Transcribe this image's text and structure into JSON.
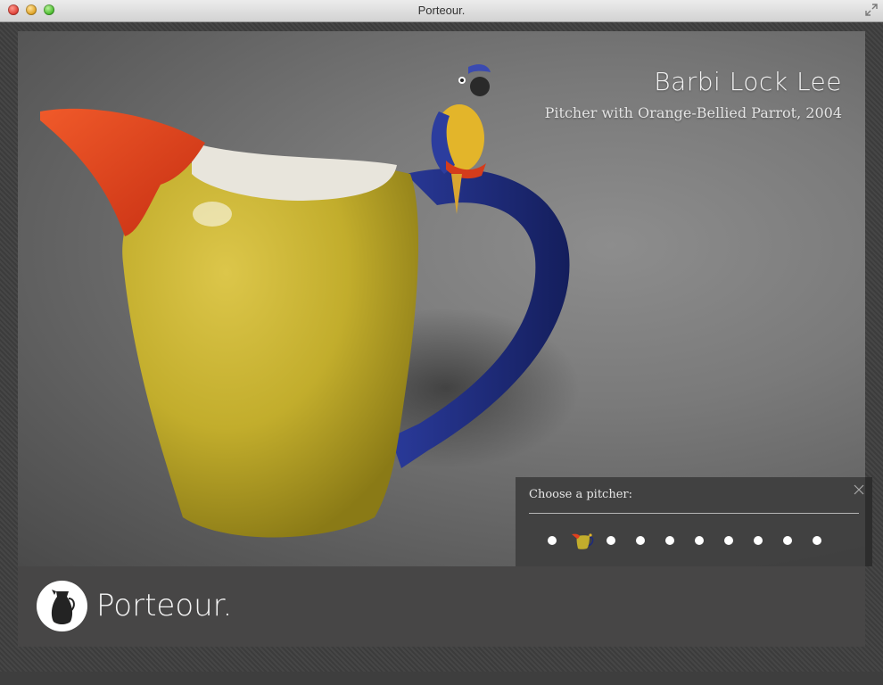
{
  "window": {
    "title": "Porteour."
  },
  "artwork": {
    "artist": "Barbi Lock Lee",
    "title": "Pitcher with Orange-Bellied Parrot, 2004",
    "colors": {
      "body": "#c2ad2c",
      "spout": "#e0401e",
      "handle": "#1d2a7a",
      "parrot": "#e3b52a"
    }
  },
  "brand": {
    "name": "Porteour."
  },
  "chooser": {
    "label": "Choose a pitcher:",
    "close_icon": "close-icon",
    "count": 10,
    "selected_index": 1
  }
}
